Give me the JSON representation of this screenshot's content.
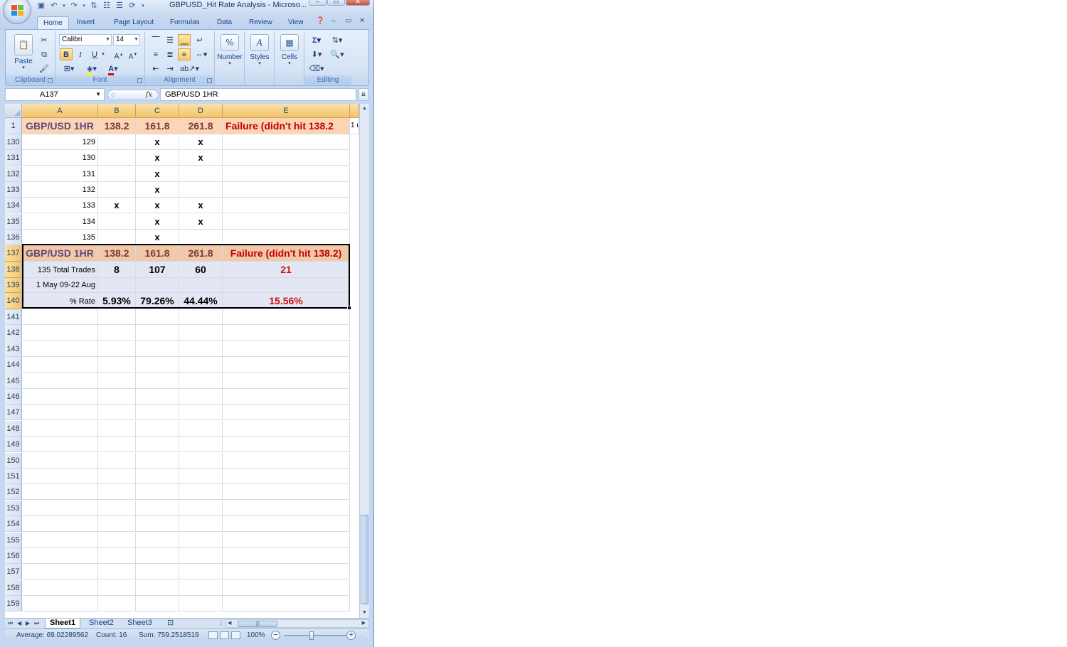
{
  "window": {
    "title": "GBPUSD_Hit Rate Analysis - Microso..."
  },
  "ribbon": {
    "tabs": [
      "Home",
      "Insert",
      "Page Layout",
      "Formulas",
      "Data",
      "Review",
      "View"
    ],
    "font_name": "Calibri",
    "font_size": "14",
    "paste_label": "Paste",
    "number_label": "Number",
    "styles_label": "Styles",
    "cells_label": "Cells",
    "groups": {
      "clipboard": "Clipboard",
      "font": "Font",
      "alignment": "Alignment",
      "editing": "Editing"
    }
  },
  "formula_bar": {
    "name_box": "A137",
    "fx": "fx",
    "value": "GBP/USD 1HR"
  },
  "columns": [
    "A",
    "B",
    "C",
    "D",
    "E"
  ],
  "overflow_text": "1 u",
  "header_row": {
    "row": "1",
    "a": "GBP/USD 1HR",
    "b": "138.2",
    "c": "161.8",
    "d": "261.8",
    "e": "Failure (didn't hit 138.2"
  },
  "rows": [
    {
      "row": "130",
      "a": "129",
      "b": "",
      "c": "x",
      "d": "x"
    },
    {
      "row": "131",
      "a": "130",
      "b": "",
      "c": "x",
      "d": "x"
    },
    {
      "row": "132",
      "a": "131",
      "b": "",
      "c": "x",
      "d": ""
    },
    {
      "row": "133",
      "a": "132",
      "b": "",
      "c": "x",
      "d": ""
    },
    {
      "row": "134",
      "a": "133",
      "b": "x",
      "c": "x",
      "d": "x"
    },
    {
      "row": "135",
      "a": "134",
      "b": "",
      "c": "x",
      "d": "x"
    },
    {
      "row": "136",
      "a": "135",
      "b": "",
      "c": "x",
      "d": ""
    }
  ],
  "summary": {
    "r137": {
      "row": "137",
      "a": "GBP/USD 1HR",
      "b": "138.2",
      "c": "161.8",
      "d": "261.8",
      "e": "Failure (didn't hit 138.2)"
    },
    "r138": {
      "row": "138",
      "a": "135 Total Trades",
      "b": "8",
      "c": "107",
      "d": "60",
      "e": "21"
    },
    "r139": {
      "row": "139",
      "a": "1 May 09-22 Aug"
    },
    "r140": {
      "row": "140",
      "a": "% Rate",
      "b": "5.93%",
      "c": "79.26%",
      "d": "44.44%",
      "e": "15.56%"
    }
  },
  "empty_rows": [
    "141",
    "142",
    "143",
    "144",
    "145",
    "146",
    "147",
    "148",
    "149",
    "150",
    "151",
    "152",
    "153",
    "154",
    "155",
    "156",
    "157",
    "158",
    "159"
  ],
  "sheets": [
    "Sheet1",
    "Sheet2",
    "Sheet3"
  ],
  "status": {
    "average": "Average: 69.02289562",
    "count": "Count: 16",
    "sum": "Sum: 759.2518519",
    "zoom": "100%"
  }
}
